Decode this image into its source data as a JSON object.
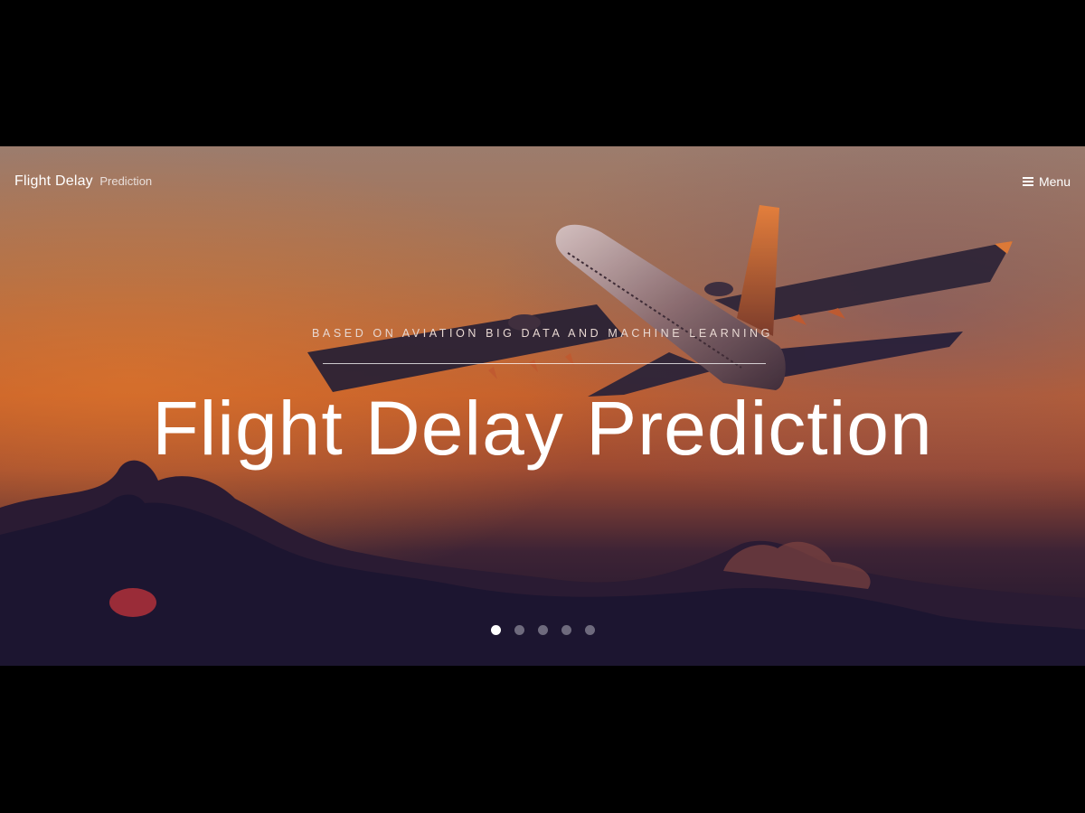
{
  "navbar": {
    "brand_main": "Flight Delay",
    "brand_sub": "Prediction",
    "menu_label": "Menu"
  },
  "hero": {
    "tagline": "BASED ON AVIATION BIG DATA AND MACHINE LEARNING",
    "headline": "Flight Delay Prediction",
    "background_image": "airplane-at-sunset",
    "slides": {
      "count": 5,
      "active_index": 0
    }
  },
  "colors": {
    "page_background": "#000000",
    "sky_top": "#a07e6e",
    "sky_horizon": "#c8612e",
    "clouds": "#1b1530",
    "text": "#ffffff"
  },
  "icons": {
    "menu": "hamburger-icon"
  }
}
